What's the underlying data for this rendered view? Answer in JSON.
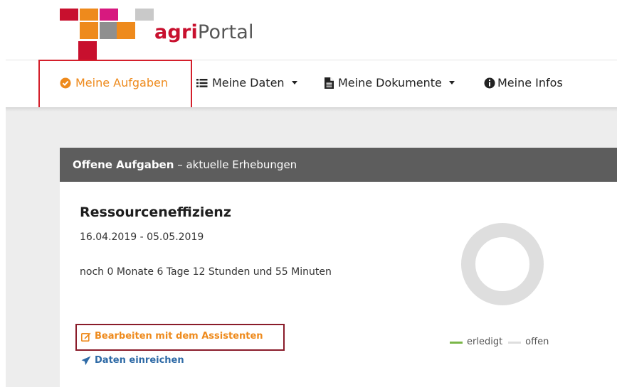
{
  "brand": {
    "part1": "agri",
    "part2": "Portal"
  },
  "colors": {
    "accent": "#ee8a1c",
    "brand_red": "#c8102e",
    "link_blue": "#2e6aa6",
    "done_green": "#7ab648",
    "open_gray": "#dedede"
  },
  "nav": {
    "items": [
      {
        "label": "Meine Aufgaben",
        "icon": "check-circle-icon",
        "active": true
      },
      {
        "label": "Meine Daten",
        "icon": "list-icon",
        "dropdown": true
      },
      {
        "label": "Meine Dokumente",
        "icon": "document-icon",
        "dropdown": true
      },
      {
        "label": "Meine Infos",
        "icon": "info-circle-icon"
      }
    ]
  },
  "panel": {
    "header_bold": "Offene Aufgaben",
    "header_rest": " – aktuelle Erhebungen"
  },
  "task": {
    "title": "Ressourceneffizienz",
    "dates": "16.04.2019 - 05.05.2019",
    "remaining": "noch 0 Monate 6 Tage 12 Stunden und 55 Minuten",
    "actions": [
      {
        "label": "Bearbeiten mit dem Assistenten",
        "icon": "edit-icon"
      },
      {
        "label": "Daten einreichen",
        "icon": "send-icon"
      }
    ],
    "progress": {
      "done": 0,
      "open": 1
    },
    "legend": {
      "done_label": "erledigt",
      "open_label": "offen"
    }
  }
}
